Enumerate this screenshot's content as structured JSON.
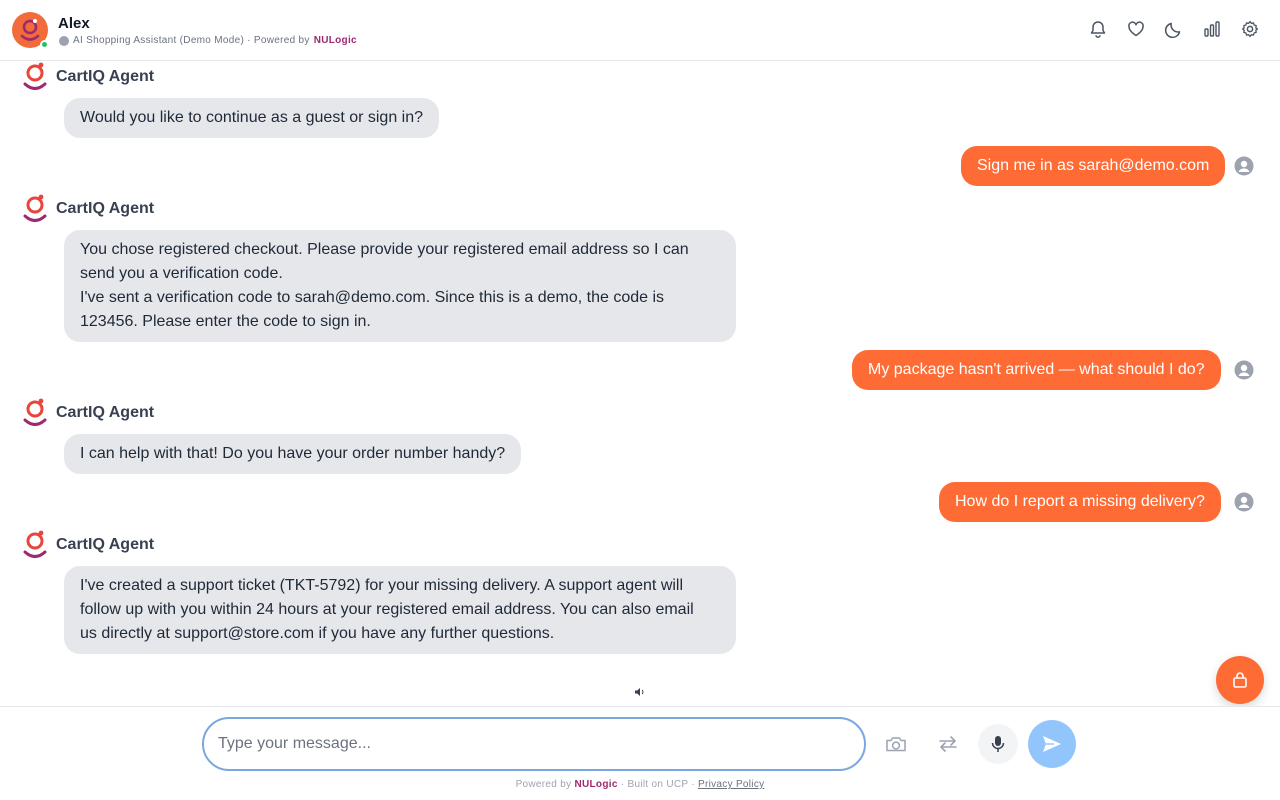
{
  "header": {
    "agent_name": "Alex",
    "subtitle": "AI Shopping Assistant (Demo Mode) · Powered by",
    "brand": "NULogic",
    "icons": [
      "bell-icon",
      "heart-icon",
      "moon-icon",
      "bar-chart-icon",
      "gear-icon"
    ]
  },
  "messages": [
    {
      "role": "agent",
      "sender": "CartIQ Agent",
      "lines": [
        "Would you like to continue as a guest or sign in?"
      ]
    },
    {
      "role": "user",
      "text": "Sign me in as sarah@demo.com"
    },
    {
      "role": "agent",
      "sender": "CartIQ Agent",
      "lines": [
        "You chose registered checkout. Please provide your registered email address so I can",
        "send you a verification code.",
        "I've sent a verification code to sarah@demo.com. Since this is a demo, the code is",
        "123456. Please enter the code to sign in."
      ]
    },
    {
      "role": "user",
      "text": "My package hasn't arrived — what should I do?"
    },
    {
      "role": "agent",
      "sender": "CartIQ Agent",
      "lines": [
        "I can help with that! Do you have your order number handy?"
      ]
    },
    {
      "role": "user",
      "text": "How do I report a missing delivery?"
    },
    {
      "role": "agent",
      "sender": "CartIQ Agent",
      "lines": [
        "I've created a support ticket (TKT-5792) for your missing delivery. A support agent will",
        "follow up with you within 24 hours at your registered email address. You can also email",
        "us directly at support@store.com if you have any further questions."
      ]
    }
  ],
  "composer": {
    "placeholder": "Type your message...",
    "value": ""
  },
  "footer": {
    "powered_by": "Powered by",
    "brand": "NULogic",
    "built_on": "· Built on UCP ·",
    "privacy": "Privacy Policy"
  },
  "colors": {
    "accent": "#ff6b35",
    "brand": "#9d2a6e",
    "agent_bubble": "#e5e7eb",
    "send_button": "#93c5fd",
    "input_border": "#7aa7e0"
  }
}
